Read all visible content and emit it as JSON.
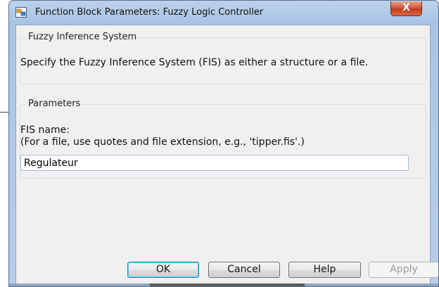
{
  "window": {
    "title": "Function Block Parameters: Fuzzy Logic Controller",
    "icon": "simulink-block-icon",
    "close_glyph": "X"
  },
  "fis_group": {
    "label": "Fuzzy Inference System",
    "description": "Specify the Fuzzy Inference System (FIS) as either a structure or a file."
  },
  "params_group": {
    "label": "Parameters",
    "fis_name_label": "FIS name:",
    "fis_name_hint": "(For a file, use quotes and file extension, e.g., 'tipper.fis'.)",
    "fis_name_value": "Regulateur"
  },
  "buttons": {
    "ok": "OK",
    "cancel": "Cancel",
    "help": "Help",
    "apply": "Apply"
  },
  "colors": {
    "close_button": "#c23b1e",
    "default_button_border": "#3c7fb1"
  }
}
